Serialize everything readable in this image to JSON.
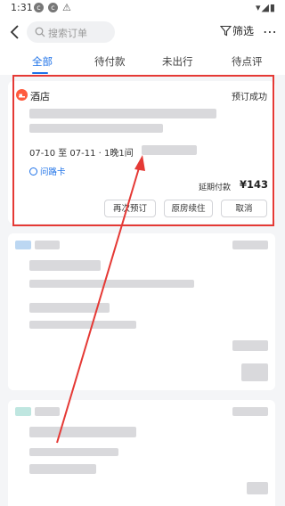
{
  "status_bar": {
    "time": "1:31",
    "warning_icon": "warning-icon",
    "right_icons": "wifi-icon signal-icon battery-icon"
  },
  "header": {
    "search_placeholder": "搜索订单",
    "filter_label": "筛选",
    "more_label": "⋯"
  },
  "tabs": [
    {
      "label": "全部",
      "active": true
    },
    {
      "label": "待付款",
      "active": false
    },
    {
      "label": "未出行",
      "active": false
    },
    {
      "label": "待点评",
      "active": false
    }
  ],
  "order": {
    "category": "酒店",
    "status": "预订成功",
    "dates": "07-10 至 07-11 · 1晚1间",
    "route_tag": "问路卡",
    "pay_label": "延期付款",
    "pay_amount": "¥143",
    "buttons": [
      "再次预订",
      "原房续住",
      "取消"
    ]
  },
  "colors": {
    "accent": "#1e72e8",
    "highlight": "#e53935",
    "hotel_icon": "#ff5a3d"
  }
}
